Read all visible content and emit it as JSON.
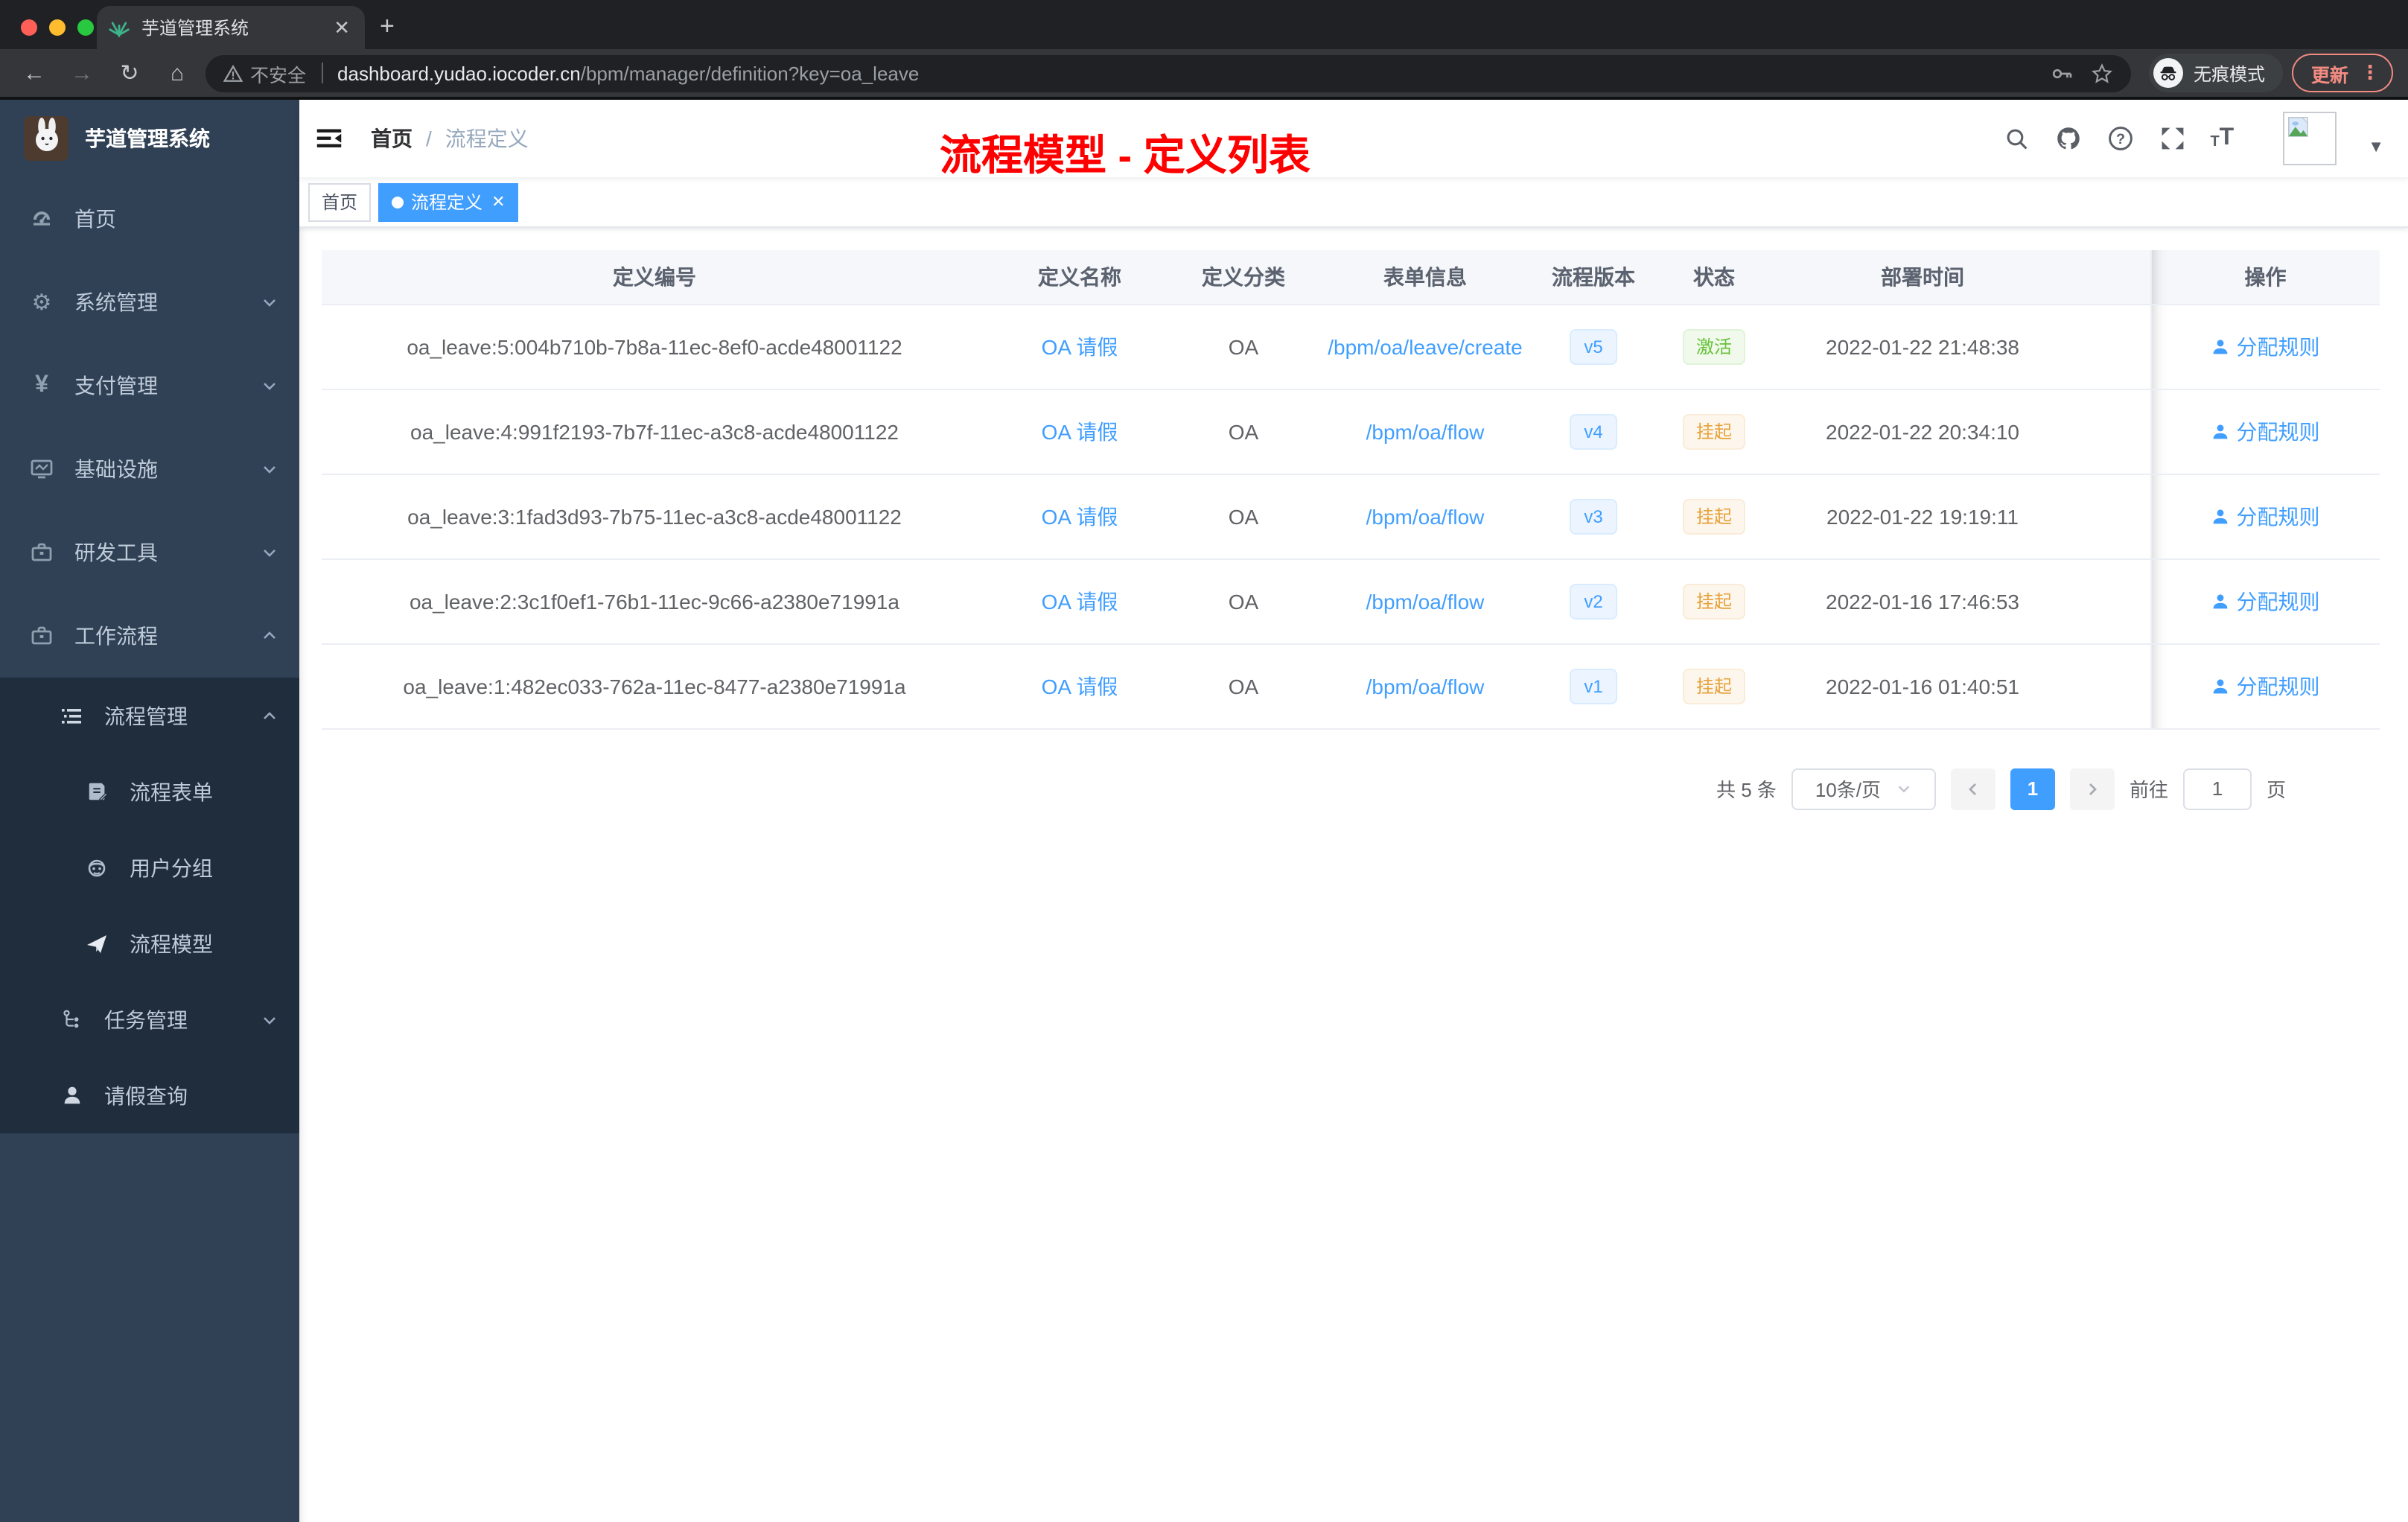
{
  "browser": {
    "tab_title": "芋道管理系统",
    "url": {
      "security_label": "不安全",
      "domain": "dashboard.yudao.iocoder.cn",
      "path": "/bpm/manager/definition?key=oa_leave"
    },
    "incognito_label": "无痕模式",
    "update_label": "更新"
  },
  "sidebar": {
    "title": "芋道管理系统",
    "items": [
      {
        "label": "首页",
        "icon": "dashboard-icon"
      },
      {
        "label": "系统管理",
        "icon": "gear-icon",
        "chevron": "down"
      },
      {
        "label": "支付管理",
        "icon": "payment-icon",
        "chevron": "down"
      },
      {
        "label": "基础设施",
        "icon": "infrastructure-icon",
        "chevron": "down"
      },
      {
        "label": "研发工具",
        "icon": "devtools-icon",
        "chevron": "down"
      },
      {
        "label": "工作流程",
        "icon": "workflow-icon",
        "chevron": "up"
      }
    ],
    "submenu": [
      {
        "label": "流程管理",
        "icon": "process-manage-icon",
        "chevron": "up"
      },
      {
        "label": "流程表单",
        "icon": "process-form-icon"
      },
      {
        "label": "用户分组",
        "icon": "user-group-icon"
      },
      {
        "label": "流程模型",
        "icon": "process-model-icon"
      },
      {
        "label": "任务管理",
        "icon": "task-manage-icon",
        "chevron": "down"
      },
      {
        "label": "请假查询",
        "icon": "leave-query-icon"
      }
    ]
  },
  "navbar": {
    "breadcrumb_home": "首页",
    "breadcrumb_separator": "/",
    "breadcrumb_current": "流程定义"
  },
  "annotation": {
    "text": "流程模型 - 定义列表",
    "color": "#ff0000"
  },
  "tags_view": {
    "items": [
      {
        "label": "首页",
        "active": false
      },
      {
        "label": "流程定义",
        "active": true
      }
    ]
  },
  "table": {
    "headers": {
      "id": "定义编号",
      "name": "定义名称",
      "category": "定义分类",
      "form": "表单信息",
      "version": "流程版本",
      "status": "状态",
      "deploy_time": "部署时间",
      "actions": "操作"
    },
    "action_label": "分配规则",
    "rows": [
      {
        "id": "oa_leave:5:004b710b-7b8a-11ec-8ef0-acde48001122",
        "name": "OA 请假",
        "category": "OA",
        "form": "/bpm/oa/leave/create",
        "version": "v5",
        "status": "激活",
        "status_type": "success",
        "deploy_time": "2022-01-22 21:48:38"
      },
      {
        "id": "oa_leave:4:991f2193-7b7f-11ec-a3c8-acde48001122",
        "name": "OA 请假",
        "category": "OA",
        "form": "/bpm/oa/flow",
        "version": "v4",
        "status": "挂起",
        "status_type": "warning",
        "deploy_time": "2022-01-22 20:34:10"
      },
      {
        "id": "oa_leave:3:1fad3d93-7b75-11ec-a3c8-acde48001122",
        "name": "OA 请假",
        "category": "OA",
        "form": "/bpm/oa/flow",
        "version": "v3",
        "status": "挂起",
        "status_type": "warning",
        "deploy_time": "2022-01-22 19:19:11"
      },
      {
        "id": "oa_leave:2:3c1f0ef1-76b1-11ec-9c66-a2380e71991a",
        "name": "OA 请假",
        "category": "OA",
        "form": "/bpm/oa/flow",
        "version": "v2",
        "status": "挂起",
        "status_type": "warning",
        "deploy_time": "2022-01-16 17:46:53"
      },
      {
        "id": "oa_leave:1:482ec033-762a-11ec-8477-a2380e71991a",
        "name": "OA 请假",
        "category": "OA",
        "form": "/bpm/oa/flow",
        "version": "v1",
        "status": "挂起",
        "status_type": "warning",
        "deploy_time": "2022-01-16 01:40:51"
      }
    ]
  },
  "pagination": {
    "total": "共 5 条",
    "page_size": "10条/页",
    "current_page": "1",
    "goto_label": "前往",
    "goto_value": "1",
    "page_unit": "页"
  },
  "colors": {
    "accent": "#409eff",
    "sidebar_bg": "#304156",
    "submenu_bg": "#1f2d3d",
    "success": "#67c23a",
    "warning": "#e6a23c",
    "annotation_red": "#ff0000"
  }
}
